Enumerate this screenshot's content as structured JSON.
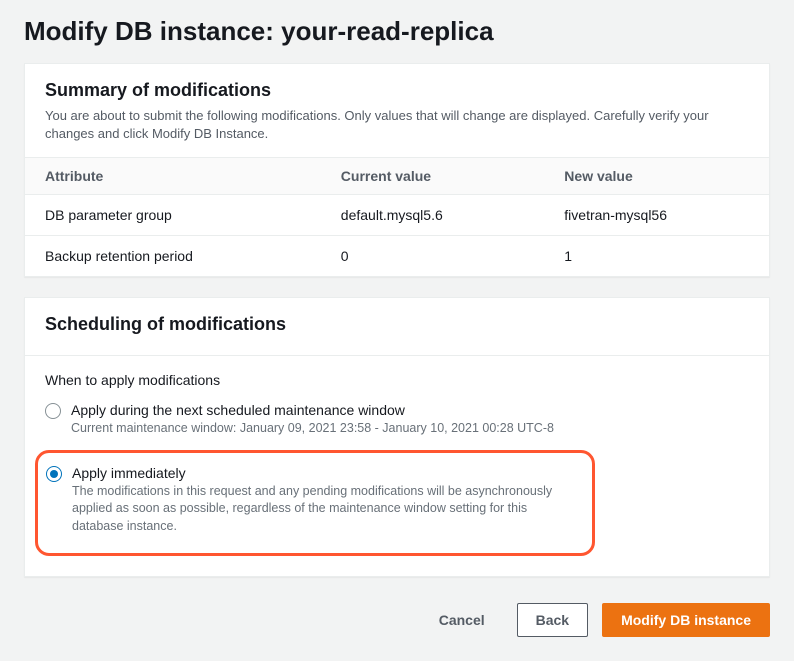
{
  "page": {
    "title": "Modify DB instance: your-read-replica"
  },
  "summary": {
    "title": "Summary of modifications",
    "desc": "You are about to submit the following modifications. Only values that will change are displayed. Carefully verify your changes and click Modify DB Instance.",
    "headers": {
      "attr": "Attribute",
      "current": "Current value",
      "new": "New value"
    },
    "rows": [
      {
        "attr": "DB parameter group",
        "current": "default.mysql5.6",
        "new": "fivetran-mysql56"
      },
      {
        "attr": "Backup retention period",
        "current": "0",
        "new": "1"
      }
    ]
  },
  "scheduling": {
    "title": "Scheduling of modifications",
    "when_label": "When to apply modifications",
    "options": [
      {
        "label": "Apply during the next scheduled maintenance window",
        "sub": "Current maintenance window: January 09, 2021 23:58 - January 10, 2021 00:28 UTC-8",
        "selected": false
      },
      {
        "label": "Apply immediately",
        "sub": "The modifications in this request and any pending modifications will be asynchronously applied as soon as possible, regardless of the maintenance window setting for this database instance.",
        "selected": true
      }
    ]
  },
  "footer": {
    "cancel": "Cancel",
    "back": "Back",
    "modify": "Modify DB instance"
  }
}
